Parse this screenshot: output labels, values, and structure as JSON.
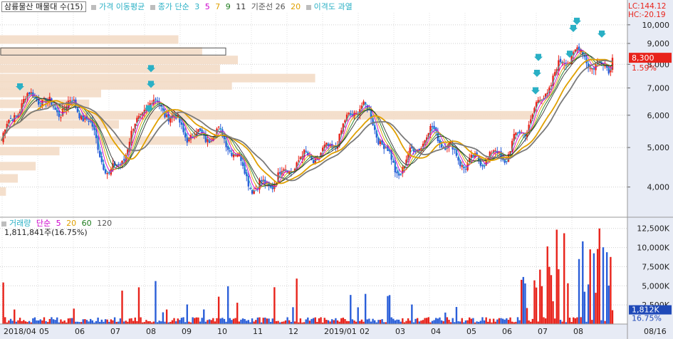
{
  "header": {
    "title": "삼륭물산 매물대 수(15)",
    "ma_label": "가격 이동평균",
    "ma_type": "종가 단순",
    "ma_periods": [
      "3",
      "5",
      "7",
      "9",
      "11"
    ],
    "base_line_label": "기준선 26",
    "base_line_period2": "20",
    "disparity_label": "이격도 과열",
    "lc": "LC:144.12",
    "hc": "HC:-20.19"
  },
  "price_axis": {
    "ticks": [
      "10,000",
      "9,000",
      "8,000",
      "7,000",
      "6,000",
      "5,000",
      "4,000"
    ],
    "current_price": "8,300",
    "change_pct": "1.59%"
  },
  "volume_panel": {
    "label": "거래량",
    "ma_type": "단순",
    "ma_periods": [
      "5",
      "20",
      "60",
      "120"
    ],
    "current_volume": "1,811,841주(16.75%)",
    "ticks": [
      "12,500K",
      "10,000K",
      "7,500K",
      "5,000K",
      "2,500K"
    ],
    "current_badge": "1,812K",
    "pct_badge": "16.75%"
  },
  "x_axis": {
    "labels": [
      "2018/04",
      "05",
      "06",
      "07",
      "08",
      "09",
      "10",
      "11",
      "12",
      "2019/01",
      "02",
      "03",
      "04",
      "05",
      "06",
      "07",
      "08",
      "08/16"
    ]
  },
  "colors": {
    "up": "#e8231b",
    "down": "#2b5fd9",
    "ma3": "#2ab0c5",
    "ma5": "#cc00cc",
    "ma7": "#e0a000",
    "ma9": "#1a7a1a",
    "ma11": "#333333",
    "base26": "#7a7a7a",
    "base20": "#e0a000",
    "volume_profile": "#f3dcc6",
    "arrow": "#2ab0c5",
    "axis_bg": "#e7ebf5"
  },
  "chart_data": {
    "type": "candlestick",
    "price_ylim": [
      3400,
      10700
    ],
    "volume_ylim": [
      0,
      13500000
    ],
    "months": [
      "2018/04",
      "05",
      "06",
      "07",
      "08",
      "09",
      "10",
      "11",
      "12",
      "2019/01",
      "02",
      "03",
      "04",
      "05",
      "06",
      "07",
      "08"
    ],
    "monthly_close": [
      5200,
      6800,
      6300,
      4300,
      6200,
      5800,
      5200,
      4200,
      4200,
      5100,
      6100,
      4600,
      5200,
      4800,
      4500,
      6800,
      8300
    ],
    "last_close": 8300,
    "last_volume": 1811841,
    "volume_profile_price_levels": [
      9200,
      8600,
      8200,
      7800,
      7400,
      7100,
      6800,
      6400,
      6000,
      5700,
      5200,
      4900,
      4500,
      4200,
      3900
    ],
    "volume_profile_relative": [
      0.3,
      0.34,
      0.4,
      0.37,
      0.53,
      0.39,
      0.17,
      0.15,
      0.9,
      0.2,
      0.39,
      0.1,
      0.06,
      0.03,
      0.01
    ]
  }
}
